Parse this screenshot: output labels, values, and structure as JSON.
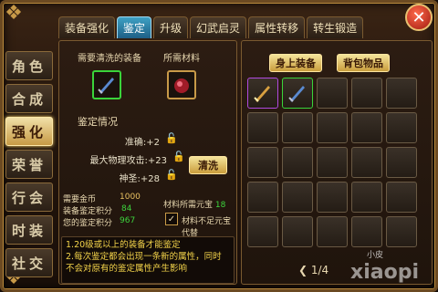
{
  "tabs": [
    {
      "label": "装备强化",
      "active": false
    },
    {
      "label": "鉴定",
      "active": true
    },
    {
      "label": "升级",
      "active": false
    },
    {
      "label": "幻武启灵",
      "active": false
    },
    {
      "label": "属性转移",
      "active": false
    },
    {
      "label": "转生锻造",
      "active": false
    }
  ],
  "close_label": "✕",
  "sidebar": [
    {
      "label": "角色",
      "active": false
    },
    {
      "label": "合成",
      "active": false
    },
    {
      "label": "强化",
      "active": true
    },
    {
      "label": "荣誉",
      "active": false
    },
    {
      "label": "行会",
      "active": false
    },
    {
      "label": "时装",
      "active": false
    },
    {
      "label": "社交",
      "active": false
    }
  ],
  "left": {
    "need_wash_label": "需要清洗的装备",
    "need_material_label": "所需材料",
    "section_title": "鉴定情况",
    "stats": [
      {
        "label": "准确:+2"
      },
      {
        "label": "最大物理攻击:+23"
      },
      {
        "label": "神圣:+28"
      }
    ],
    "wash_button": "清洗",
    "costs": {
      "gold_label": "需要金币",
      "gold_value": "1000",
      "points_label": "装备鉴定积分",
      "points_value": "84",
      "your_points_label": "您的鉴定积分",
      "your_points_value": "967",
      "material_label": "材料所需元宝",
      "material_value": "18",
      "substitute_label": "材料不足元宝代替"
    },
    "notes": [
      "1.20级或以上的装备才能鉴定",
      "2.每次鉴定都会出现一条新的属性，同时",
      "不会对原有的鉴定属性产生影响"
    ]
  },
  "right": {
    "tab_equipped": "身上装备",
    "tab_bag": "背包物品",
    "pager": "1/4"
  },
  "watermark": {
    "text": "xiaopi",
    "small": "小皮"
  },
  "colors": {
    "accent_gold": "#c99d3c",
    "tab_active_blue": "#3ea1c4",
    "value_green": "#3dd33d",
    "note_yellow": "#f3d34a"
  }
}
